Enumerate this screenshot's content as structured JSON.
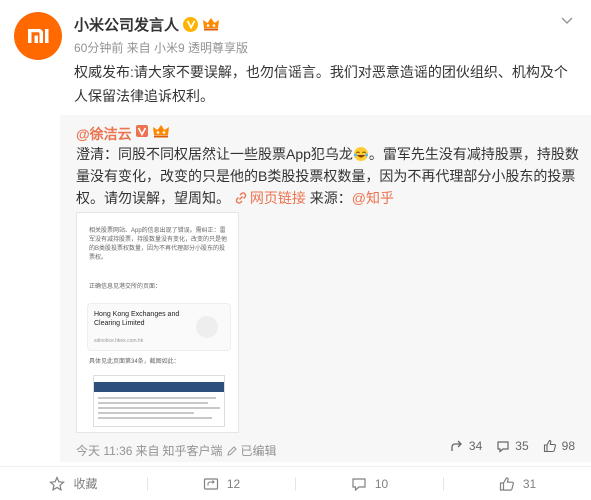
{
  "header": {
    "name": "小米公司发言人",
    "meta": "60分钟前 来自 小米9 透明尊享版"
  },
  "post": {
    "text": "权威发布:请大家不要误解，也勿信谣言。我们对恶意造谣的团伙组织、机构及个人保留法律追诉权利。"
  },
  "repost": {
    "user": "@徐洁云",
    "text_before": "澄清：同股不同权居然让一些股票App犯乌龙",
    "text_after": "。雷军先生没有减持股票，持股数量没有变化，改变的只是他的B类股投票权数量，因为不再代理部分小股东的投票权。请勿误解，望周知。",
    "link_label": "网页链接",
    "source_label": " 来源：",
    "source_link": "@知乎",
    "image": {
      "para1": "相关股票网站、App的信息出现了错误。需纠正：雷军没有减持股票，持股数量没有变化，改变的只是他的B类股投票权数量，因为不再代理部分小股东的投票权。",
      "para2": "正确信息见港交所的页面：",
      "card_title": "Hong Kong Exchanges and Clearing Limited",
      "card_url": "sdinotice.hkex.com.hk",
      "para3": "具体见此页面第34条，截图如此："
    },
    "footer": {
      "time": "今天 11:36",
      "from_label": "来自",
      "client": "知乎客户端",
      "edit": "已编辑"
    },
    "actions": {
      "forward": "34",
      "comment": "35",
      "like": "98"
    }
  },
  "bottom": {
    "favorite": "收藏",
    "forward": "12",
    "comment": "10",
    "like": "31"
  },
  "colors": {
    "brand": "#ff6900",
    "link": "#eb7350",
    "muted": "#939393"
  }
}
